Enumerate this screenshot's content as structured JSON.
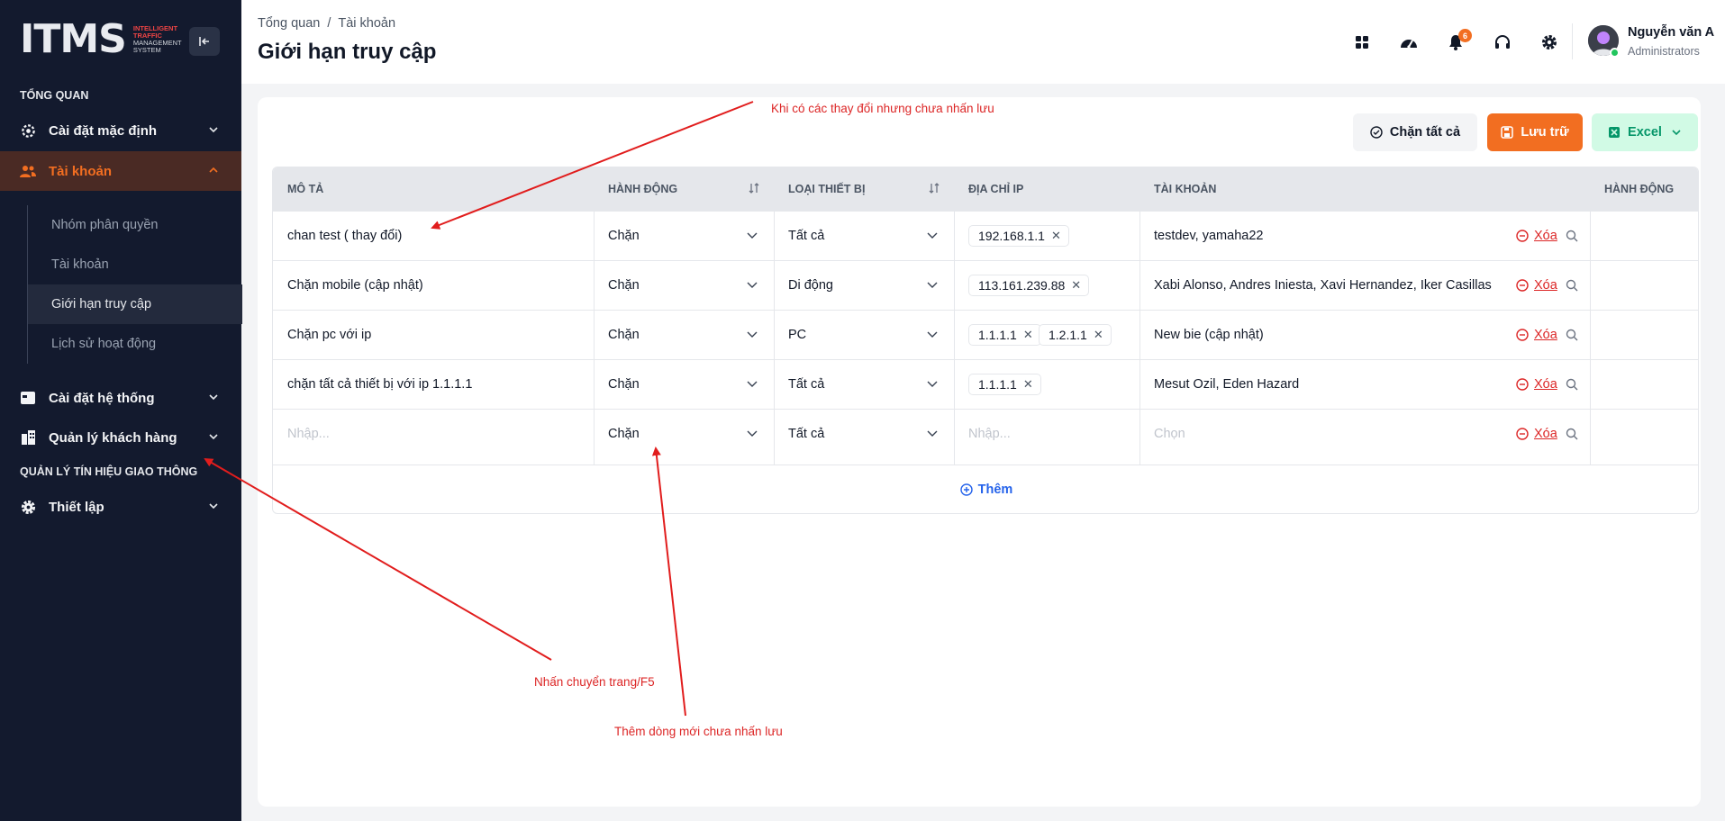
{
  "logo": {
    "text": "ITMS",
    "sub1": "INTELLIGENT",
    "sub2": "TRAFFIC",
    "sub3": "MANAGEMENT",
    "sub4": "SYSTEM"
  },
  "sidebar": {
    "section_overview": "TỔNG QUAN",
    "section_traffic": "QUẢN LÝ TÍN HIỆU GIAO THÔNG",
    "items": [
      {
        "label": "Cài đặt mặc định"
      },
      {
        "label": "Tài khoản"
      },
      {
        "label": "Cài đặt hệ thống"
      },
      {
        "label": "Quản lý khách hàng"
      },
      {
        "label": "Thiết lập"
      }
    ],
    "sub_items": [
      {
        "label": "Nhóm phân quyền"
      },
      {
        "label": "Tài khoản"
      },
      {
        "label": "Giới hạn truy cập"
      },
      {
        "label": "Lịch sử hoạt động"
      }
    ]
  },
  "header": {
    "breadcrumb": [
      "Tổng quan",
      "Tài khoản"
    ],
    "breadcrumb_sep": "/",
    "title": "Giới hạn truy cập",
    "notifications": "6",
    "user_name": "Nguyễn văn A",
    "user_role": "Administrators"
  },
  "toolbar": {
    "block_all": "Chặn tất cả",
    "save": "Lưu trữ",
    "excel": "Excel"
  },
  "table": {
    "headers": [
      "MÔ TẢ",
      "HÀNH ĐỘNG",
      "LOẠI THIẾT BỊ",
      "ĐỊA CHỈ IP",
      "TÀI KHOẢN",
      "HÀNH ĐỘNG"
    ],
    "rows": [
      {
        "desc": "chan test ( thay đổi)",
        "action": "Chặn",
        "device": "Tất cả",
        "ips": [
          "192.168.1.1"
        ],
        "accounts": "testdev, yamaha22",
        "delete": "Xóa"
      },
      {
        "desc": "Chặn mobile (cập nhật)",
        "action": "Chặn",
        "device": "Di động",
        "ips": [
          "113.161.239.88"
        ],
        "accounts": "Xabi Alonso, Andres Iniesta, Xavi Hernandez, Iker Casillas",
        "delete": "Xóa"
      },
      {
        "desc": "Chặn pc với ip",
        "action": "Chặn",
        "device": "PC",
        "ips": [
          "1.1.1.1",
          "1.2.1.1"
        ],
        "accounts": "New bie (cập nhật)",
        "delete": "Xóa"
      },
      {
        "desc": "chặn tất cả thiết bị với ip 1.1.1.1",
        "action": "Chặn",
        "device": "Tất cả",
        "ips": [
          "1.1.1.1"
        ],
        "accounts": "Mesut Ozil, Eden Hazard",
        "delete": "Xóa"
      }
    ],
    "new_row": {
      "desc_placeholder": "Nhập...",
      "action": "Chặn",
      "device": "Tất cả",
      "ip_placeholder": "Nhập...",
      "account_placeholder": "Chọn",
      "delete": "Xóa"
    },
    "add_label": "Thêm"
  },
  "annotations": {
    "unsaved_changes": "Khi có các thay đổi nhưng chưa nhấn lưu",
    "navigate": "Nhấn chuyển trang/F5",
    "new_row_unsaved": "Thêm dòng mới chưa nhấn lưu"
  },
  "colors": {
    "sidebar_bg": "#131a2e",
    "accent": "#f26e21",
    "excel_green": "#059669",
    "danger": "#dc2626",
    "link_blue": "#2563eb",
    "annotation_red": "#dc2626"
  }
}
